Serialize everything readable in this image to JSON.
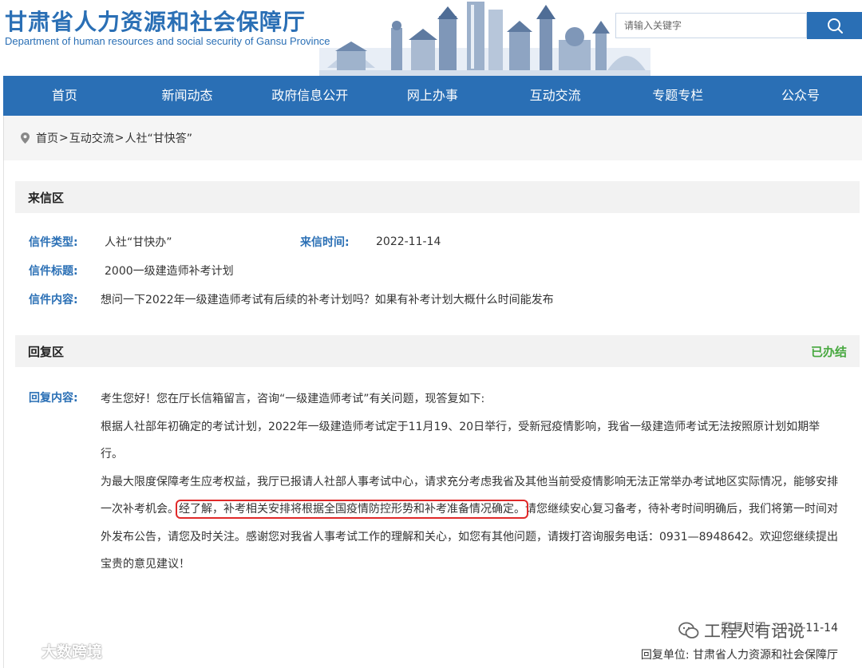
{
  "header": {
    "title": "甘肃省人力资源和社会保障厅",
    "subtitle": "Department of human resources and social security of Gansu Province",
    "search_placeholder": "请输入关键字"
  },
  "nav": {
    "items": [
      {
        "label": "首页"
      },
      {
        "label": "新闻动态"
      },
      {
        "label": "政府信息公开"
      },
      {
        "label": "网上办事"
      },
      {
        "label": "互动交流"
      },
      {
        "label": "专题专栏"
      },
      {
        "label": "公众号"
      }
    ]
  },
  "breadcrumb": {
    "home": "首页",
    "sep": ">",
    "section": "互动交流",
    "current": "人社“甘快答”"
  },
  "letter": {
    "section_title": "来信区",
    "type_label": "信件类型:",
    "type_value": "人社“甘快办”",
    "time_label": "来信时间:",
    "time_value": "2022-11-14",
    "subject_label": "信件标题:",
    "subject_value": "2000一级建造师补考计划",
    "content_label": "信件内容:",
    "content_value": "想问一下2022年一级建造师考试有后续的补考计划吗？如果有补考计划大概什么时间能发布"
  },
  "reply": {
    "section_title": "回复区",
    "status": "已办结",
    "content_label": "回复内容:",
    "para1": "考生您好！您在厅长信箱留言，咨询“一级建造师考试”有关问题，现答复如下:",
    "para2": "根据人社部年初确定的考试计划，2022年一级建造师考试定于11月19、20日举行，受新冠疫情影响，我省一级建造师考试无法按照原计划如期举行。",
    "para3_before": "为最大限度保障考生应考权益，我厅已报请人社部人事考试中心，请求充分考虑我省及其他当前受疫情影响无法正常举办考试地区实际情况，能够安排一次补考机会。",
    "para3_highlight": "经了解，补考相关安排将根据全国疫情防控形势和补考准备情况确定。",
    "para3_after": "请您继续安心复习备考，待补考时间明确后，我们将第一时间对外发布公告，请您及时关注。感谢您对我省人事考试工作的理解和关心，如您有其他问题，请拨打咨询服务电话：0931—8948642。欢迎您继续提出宝贵的意见建议！",
    "time_label": "回复时间:",
    "time_value": "2022-11-14",
    "unit_label": "回复单位:",
    "unit_value": "甘肃省人力资源和社会保障厅"
  },
  "watermarks": {
    "left": "大数跨境",
    "right": "工程人有话说"
  },
  "colors": {
    "brand_blue": "#2a6fb5",
    "status_green": "#47a83f",
    "highlight_red": "#e02a2a"
  }
}
